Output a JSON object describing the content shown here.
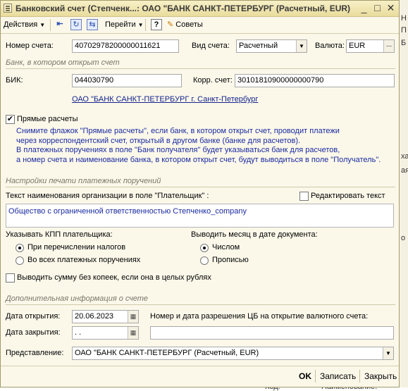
{
  "window": {
    "title": "Банковский счет (Степченк...: ОАО \"БАНК САНКТ-ПЕТЕРБУРГ (Расчетный, EUR)",
    "controls": {
      "minimize": "_",
      "maximize": "□",
      "close": "✕"
    }
  },
  "toolbar": {
    "actions": "Действия",
    "goto": "Перейти",
    "help": "?",
    "tips": "Советы"
  },
  "account": {
    "number_label": "Номер счета:",
    "number_value": "40702978200000011621",
    "type_label": "Вид счета:",
    "type_value": "Расчетный",
    "currency_label": "Валюта:",
    "currency_value": "EUR",
    "currency_btn": "..."
  },
  "bank_section": {
    "title": "Банк, в котором открыт счет",
    "bik_label": "БИК:",
    "bik_value": "044030790",
    "corr_label": "Корр. счет:",
    "corr_value": "30101810900000000790",
    "bank_link": "ОАО \"БАНК САНКТ-ПЕТЕРБУРГ г. Санкт-Петербург"
  },
  "direct": {
    "label": "Прямые расчеты",
    "checked": true,
    "info": "Снимите флажок \"Прямые расчеты\", если банк, в котором открыт счет, проводит платежи\nчерез корреспондентский счет, открытый в другом банке (банке для расчетов).\nВ платежных поручениях в поле \"Банк получателя\" будет указываться банк для расчетов,\nа номер счета и наименование банка, в котором открыт счет, будут выводиться в поле \"Получатель\"."
  },
  "print_section": {
    "title": "Настройки печати платежных поручений",
    "payer_label": "Текст наименования организации в поле \"Плательщик\" :",
    "edit_text_label": "Редактировать текст",
    "payer_text": "Общество с ограниченной ответственностью Степченко_company",
    "kpp_label": "Указывать КПП плательщика:",
    "kpp_options": [
      "При перечислении налогов",
      "Во всех платежных поручениях"
    ],
    "month_label": "Выводить месяц в дате документа:",
    "month_options": [
      "Числом",
      "Прописью"
    ],
    "no_kopecks_label": "Выводить сумму без копеек, если она в целых рублях"
  },
  "extra_section": {
    "title": "Дополнительная информация о счете",
    "open_date_label": "Дата открытия:",
    "open_date_value": "20.06.2023",
    "close_date_label": "Дата закрытия:",
    "close_date_value": " .  .",
    "cb_label": "Номер и дата разрешения ЦБ на открытие валютного счета:",
    "cb_value": "",
    "representation_label": "Представление:",
    "representation_value": "ОАО \"БАНК САНКТ-ПЕТЕРБУРГ (Расчетный, EUR)"
  },
  "footer": {
    "ok": "OK",
    "save": "Записать",
    "close": "Закрыть"
  },
  "background_fragments": {
    "right_top_1": "Н",
    "right_top_2": "П",
    "right_top_3": "Б",
    "right_mid_1": "ха",
    "right_mid_2": "ая",
    "right_mid_3": "о",
    "bottom_1": "Код:",
    "bottom_2": "Наименование:"
  },
  "colors": {
    "window_bg": "#fbf8ea",
    "title_bg": "#e9dc9c",
    "info_text": "#1a2aa0",
    "link": "#15248c"
  }
}
